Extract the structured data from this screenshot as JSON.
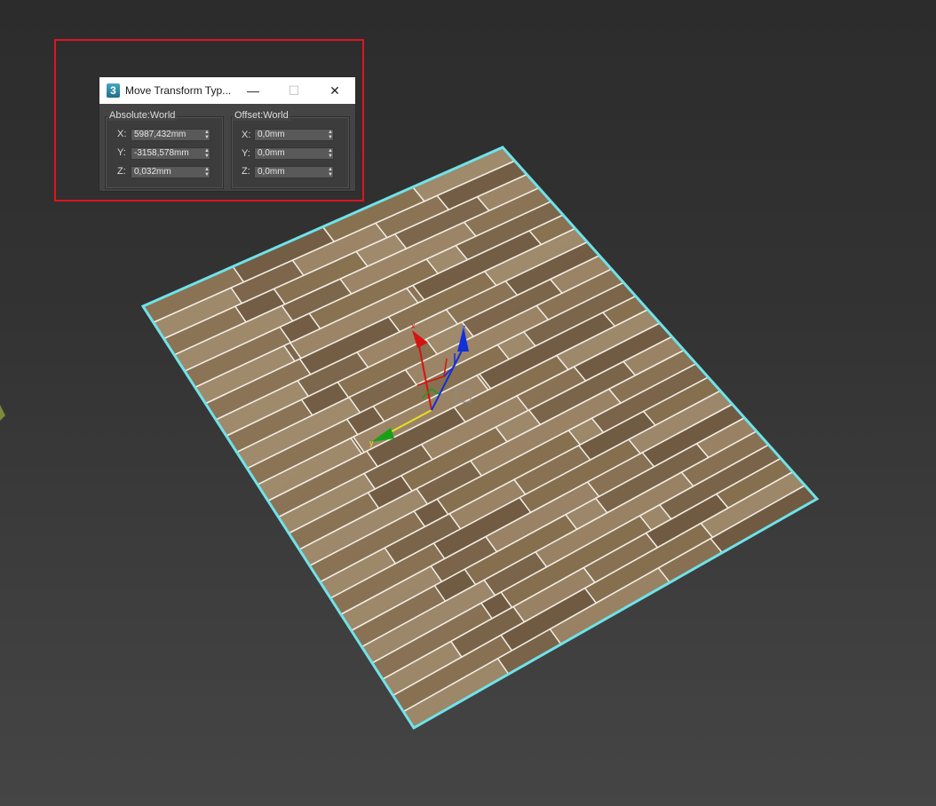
{
  "dialog": {
    "title": "Move Transform Typ...",
    "app_icon_glyph": "3",
    "minimize_glyph": "—",
    "maximize_glyph": "☐",
    "close_glyph": "✕",
    "absolute": {
      "label": "Absolute:World",
      "x_label": "X:",
      "x_value": "5987,432mm",
      "y_label": "Y:",
      "y_value": "-3158,578mm",
      "z_label": "Z:",
      "z_value": "0,032mm"
    },
    "offset": {
      "label": "Offset:World",
      "x_label": "X:",
      "x_value": "0,0mm",
      "y_label": "Y:",
      "y_value": "0,0mm",
      "z_label": "Z:",
      "z_value": "0,0mm"
    }
  },
  "gizmo": {
    "x_axis_label": "x",
    "y_axis_label": "y",
    "z_axis_label": "z"
  },
  "colors": {
    "highlight_border": "#e0141e",
    "selection_outline": "#6fe3ea",
    "x_axis": "#d41414",
    "y_axis": "#18a018",
    "z_axis": "#1030d8",
    "active_axis": "#e8e020"
  }
}
